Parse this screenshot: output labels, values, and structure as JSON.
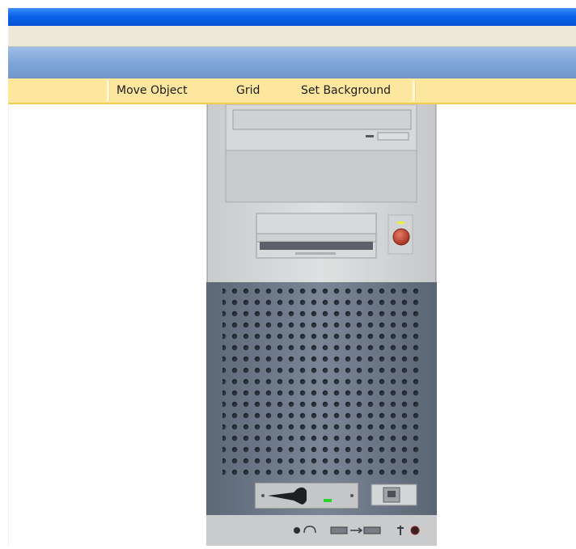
{
  "window": {
    "title_color": "#0553d6",
    "toolbar_color": "#fde79f"
  },
  "toolbar": {
    "move_object_label": "Move Object",
    "grid_label": "Grid",
    "set_background_label": "Set Background"
  },
  "canvas": {
    "object": {
      "name": "computer-tower",
      "power_led_color": "#e7f03a",
      "power_button_color": "#b23a2c",
      "card_led_color": "#2cd22c",
      "mesh_color": "#6f7b8d"
    }
  }
}
